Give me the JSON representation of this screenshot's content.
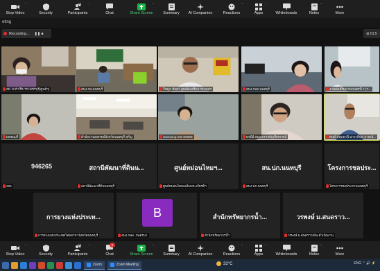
{
  "top_toolbar": [
    {
      "label": "Stop Video",
      "icon": "video-camera-icon"
    },
    {
      "label": "Security",
      "icon": "shield-icon"
    },
    {
      "label": "Participants",
      "icon": "participants-icon",
      "count": "19"
    },
    {
      "label": "Chat",
      "icon": "chat-icon"
    },
    {
      "label": "Share Screen",
      "icon": "share-screen-icon",
      "accent": "#20b14a"
    },
    {
      "label": "Summary",
      "icon": "summary-icon"
    },
    {
      "label": "AI Companion",
      "icon": "ai-companion-icon"
    },
    {
      "label": "Reactions",
      "icon": "reactions-icon"
    },
    {
      "label": "Apps",
      "icon": "apps-icon"
    },
    {
      "label": "Whiteboards",
      "icon": "whiteboard-icon"
    },
    {
      "label": "Notes",
      "icon": "notes-icon"
    },
    {
      "label": "More",
      "icon": "more-icon"
    }
  ],
  "bottom_toolbar": [
    {
      "label": "Stop Video",
      "icon": "video-camera-icon"
    },
    {
      "label": "Security",
      "icon": "shield-icon"
    },
    {
      "label": "Participants",
      "icon": "participants-icon",
      "count": "19"
    },
    {
      "label": "Chat",
      "icon": "chat-icon",
      "badge": "1"
    },
    {
      "label": "Share Screen",
      "icon": "share-screen-icon",
      "accent": "#20b14a"
    },
    {
      "label": "Summary",
      "icon": "summary-icon"
    },
    {
      "label": "AI Companion",
      "icon": "ai-companion-icon"
    },
    {
      "label": "Reactions",
      "icon": "reactions-icon"
    },
    {
      "label": "Apps",
      "icon": "apps-icon"
    },
    {
      "label": "Whiteboards",
      "icon": "whiteboard-icon"
    },
    {
      "label": "Notes",
      "icon": "notes-icon"
    },
    {
      "label": "More",
      "icon": "more-icon"
    }
  ],
  "window_title": "eting",
  "recording": {
    "label": "Recording...",
    "controls": "❚❚ ■"
  },
  "view_button": "⊞ 01:5",
  "tiles_row1": [
    {
      "caption": "สถ. อ.ท่าเรือ วร.เพชรบุรี(ศูนย์ฯ)",
      "scene": "office-woman-mask"
    },
    {
      "caption": "สนง.กษ.นนทบุรี",
      "scene": "office-room"
    },
    {
      "caption": "วิชญา ศักดา สูนย์ส่งเสริมการเกษตร",
      "scene": "man-glasses"
    },
    {
      "caption": "สนง.กษจ.นนทบุรี",
      "scene": "woman-office"
    },
    {
      "caption": "งานส่งเสริมการเกษตรที่ 7 (ร...",
      "scene": "woman-side"
    }
  ],
  "tiles_row2": [
    {
      "caption": "ผลชนบุรี",
      "scene": "woman-small"
    },
    {
      "caption": "สำนักงานสหกรณ์จังหวัดนนทบุรี สุกัญ",
      "scene": "office-ceiling"
    },
    {
      "caption": "Samsung SM-S908E",
      "scene": "woman-seated"
    },
    {
      "caption": "พจนีย์ สนง.ตรวจบัญชีสหกรณ์",
      "scene": "older-woman"
    },
    {
      "caption": "ศนท์.ปทุมธานี นาวาสีนพ ภาคเอ้...",
      "scene": "man-closeup",
      "active": true
    }
  ],
  "tiles_row3": [
    {
      "name": "946265",
      "caption": "265"
    },
    {
      "name": "สถานีพัฒนาที่ดินน...",
      "caption": "สถานีพัฒนาที่ดินนนทบุรี"
    },
    {
      "name": "ศูนย์หม่อนไหมฯ...",
      "caption": "ศูนย์หม่อนไหมเฉลิมพระเกียรติฯ"
    },
    {
      "name": "สน.ปภ.นนทบุรี",
      "caption": "สนง.ปภ.นนทบุรี"
    },
    {
      "name": "โครงการชลประ...",
      "caption": "โครงการชลประทานนนทบุรี"
    }
  ],
  "tiles_row4": [
    {
      "name": "การยางแห่งประเท...",
      "caption": "การยางแห่งประเทศไทยสาขาจังหวัดนนทบุรี"
    },
    {
      "avatar": "B",
      "caption": "สนง.กษจ. กษตรนา"
    },
    {
      "name": "สำนักทรัพยากรน้ำ...",
      "caption": "สำนักทรัพยากรน้ำ"
    },
    {
      "name": "วรพงษ์ ม.สนดราว...",
      "caption": "วรพงษ์ ม.สนดราวเพ้น ดำเนินงาน"
    }
  ],
  "taskbar": {
    "apps": [
      {
        "label": "Zoom"
      },
      {
        "label": "Zoom Meeting"
      }
    ],
    "weather": "32°C",
    "tray": "ENG  ⌃  🔊  ⚡"
  },
  "colors": {
    "accent_green": "#20b14a",
    "mute_red": "#e0302e",
    "active_border": "#d6e24a",
    "avatar_purple": "#8a2bbf"
  }
}
